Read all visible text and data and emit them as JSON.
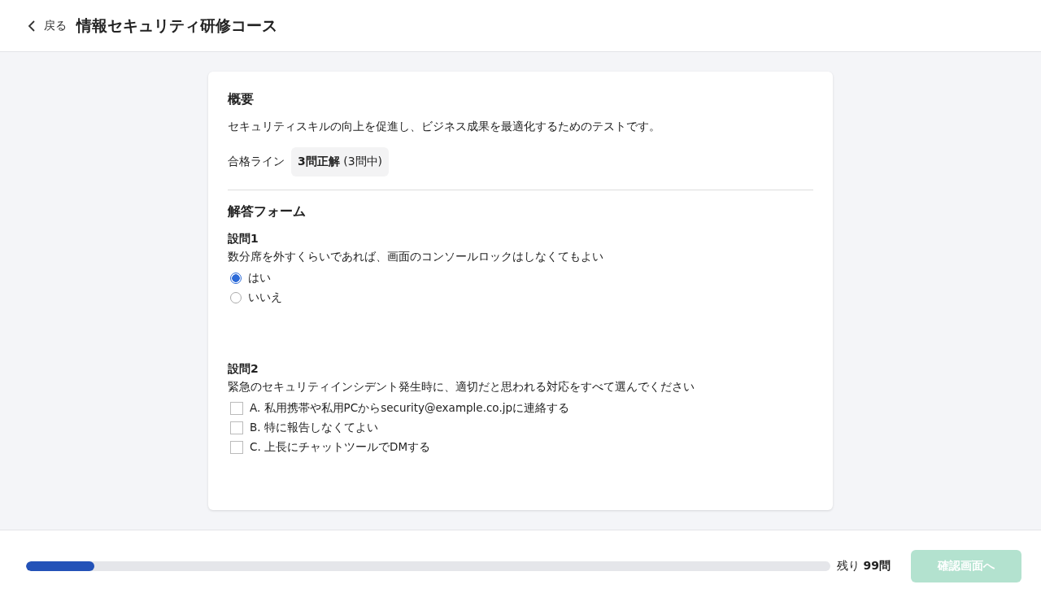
{
  "header": {
    "back_label": "戻る",
    "title": "情報セキュリティ研修コース"
  },
  "overview": {
    "heading": "概要",
    "description": "セキュリティスキルの向上を促進し、ビジネス成果を最適化するためのテストです。",
    "pass_label": "合格ライン",
    "pass_value": "**3問正解** (3問中)"
  },
  "form": {
    "heading": "解答フォーム",
    "questions": [
      {
        "kind": "radio",
        "number": "設問1",
        "text": "数分席を外すくらいであれば、画面のコンソールロックはしなくてもよい",
        "options": [
          {
            "label": "はい",
            "selected": true
          },
          {
            "label": "いいえ",
            "selected": false
          }
        ]
      },
      {
        "kind": "checkbox",
        "number": "設問2",
        "text": "緊急のセキュリティインシデント発生時に、適切だと思われる対応をすべて選んでください",
        "options": [
          {
            "label": "A. 私用携帯や私用PCからsecurity@example.co.jpに連絡する",
            "checked": false
          },
          {
            "label": "B. 特に報告しなくてよい",
            "checked": false
          },
          {
            "label": "C. 上長にチャットツールでDMする",
            "checked": false
          }
        ]
      }
    ]
  },
  "footer": {
    "progress": {
      "level": 0.085
    },
    "remaining": "残り **99問**",
    "confirm_button": {
      "label": "確認画面へ",
      "disabled": true
    }
  }
}
